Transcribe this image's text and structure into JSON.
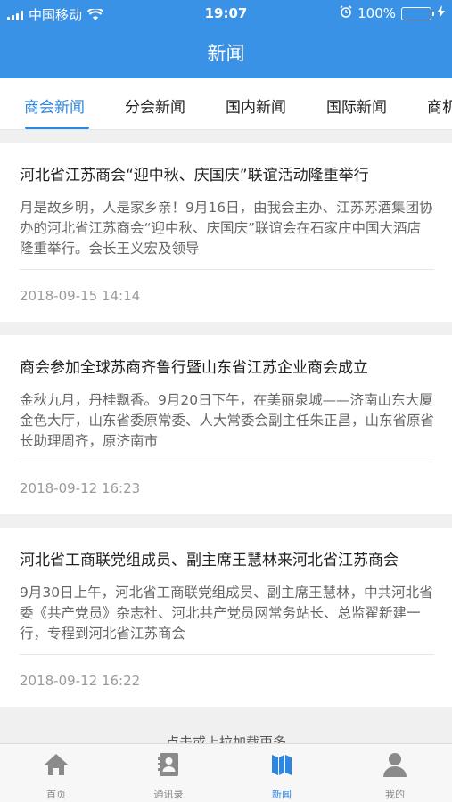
{
  "status_bar": {
    "carrier": "中国移动",
    "time": "19:07",
    "battery": "100%"
  },
  "nav": {
    "title": "新闻"
  },
  "tabs": [
    {
      "label": "商会新闻",
      "active": true
    },
    {
      "label": "分会新闻",
      "active": false
    },
    {
      "label": "国内新闻",
      "active": false
    },
    {
      "label": "国际新闻",
      "active": false
    },
    {
      "label": "商机",
      "active": false
    }
  ],
  "news": [
    {
      "title": "河北省江苏商会“迎中秋、庆国庆”联谊活动隆重举行",
      "summary": "月是故乡明，人是家乡亲！9月16日，由我会主办、江苏苏酒集团协办的河北省江苏商会“迎中秋、庆国庆”联谊会在石家庄中国大酒店隆重举行。会长王义宏及领导",
      "date": "2018-09-15 14:14"
    },
    {
      "title": "商会参加全球苏商齐鲁行暨山东省江苏企业商会成立",
      "summary": "  金秋九月，丹桂飘香。9月20日下午，在美丽泉城——济南山东大厦金色大厅，山东省委原常委、人大常委会副主任朱正昌，山东省原省长助理周齐，原济南市",
      "date": "2018-09-12 16:23"
    },
    {
      "title": "河北省工商联党组成员、副主席王慧林来河北省江苏商会",
      "summary": " 9月30日上午，河北省工商联党组成员、副主席王慧林，中共河北省委《共产党员》杂志社、河北共产党员网常务站长、总监翟新建一行，专程到河北省江苏商会",
      "date": "2018-09-12 16:22"
    }
  ],
  "load_more": "点击或上拉加载更多",
  "tabbar": [
    {
      "label": "首页",
      "icon": "home-icon",
      "active": false
    },
    {
      "label": "通讯录",
      "icon": "contacts-icon",
      "active": false
    },
    {
      "label": "新闻",
      "icon": "news-icon",
      "active": true
    },
    {
      "label": "我的",
      "icon": "profile-icon",
      "active": false
    }
  ],
  "colors": {
    "primary": "#3a92e6",
    "active_tab": "#2e86de",
    "battery": "#4cd964"
  }
}
